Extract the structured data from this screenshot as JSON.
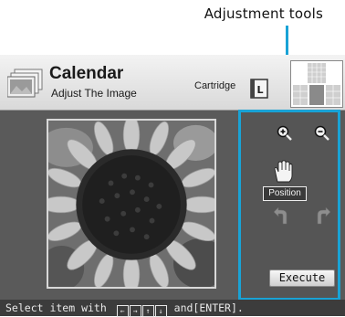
{
  "callout": {
    "label": "Adjustment tools",
    "color": "#19a3d6"
  },
  "header": {
    "title": "Calendar",
    "subtitle": "Adjust The Image",
    "cartridge_label": "Cartridge",
    "cartridge_letter": "L"
  },
  "photo": {
    "subject": "sunflower"
  },
  "tools": {
    "zoom_in_icon": "zoom-in-icon",
    "zoom_out_icon": "zoom-out-icon",
    "position_icon": "hand-icon",
    "position_label": "Position",
    "rotate_left_icon": "rotate-left-icon",
    "rotate_right_icon": "rotate-right-icon",
    "execute_label": "Execute"
  },
  "status": {
    "prefix": "Select item with",
    "keys": [
      "←",
      "→",
      "↑",
      "↓"
    ],
    "suffix": "and[ENTER]."
  }
}
